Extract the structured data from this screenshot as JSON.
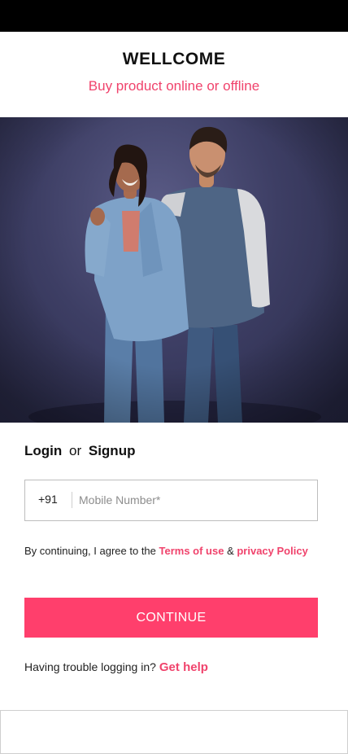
{
  "header": {
    "title": "WELLCOME",
    "subtitle": "Buy product online or offline"
  },
  "login": {
    "heading_login": "Login",
    "heading_or": "or",
    "heading_signup": "Signup",
    "country_code": "+91",
    "phone_placeholder": "Mobile Number*",
    "phone_value": ""
  },
  "terms": {
    "prefix": "By continuing, I agree to the ",
    "terms_link": "Terms of use",
    "amp": " & ",
    "privacy_link": "privacy Policy"
  },
  "continue_button": {
    "label": "CONTINUE"
  },
  "help": {
    "text": "Having trouble logging in?",
    "link": "Get help"
  },
  "colors": {
    "accent": "#ff3f6c",
    "status_bar": "#000000",
    "hero_background": "#3d3e64"
  }
}
